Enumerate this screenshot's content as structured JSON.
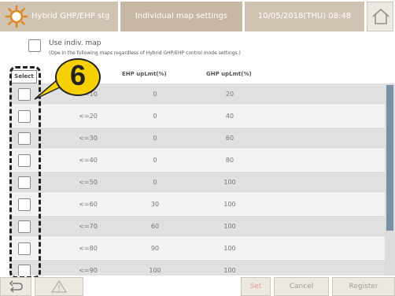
{
  "header": {
    "title": "Hybrid GHP/EHP stg",
    "mode": "Individual map settings",
    "datetime": "10/05/2018(THU) 08:48",
    "sun_icon": "sun-icon",
    "home_icon": "home-icon"
  },
  "use_map": {
    "label": "Use indiv. map",
    "note": "(Ope          in the following maps regardless of Hybrid GHP/EHP control mode settings.)"
  },
  "table": {
    "select_header": "Select",
    "columns": [
      "EHP upLmt(%)",
      "GHP upLmt(%)"
    ],
    "rows": [
      {
        "cond": "<=10",
        "ehp": "0",
        "ghp": "20"
      },
      {
        "cond": "<=20",
        "ehp": "0",
        "ghp": "40"
      },
      {
        "cond": "<=30",
        "ehp": "0",
        "ghp": "60"
      },
      {
        "cond": "<=40",
        "ehp": "0",
        "ghp": "80"
      },
      {
        "cond": "<=50",
        "ehp": "0",
        "ghp": "100"
      },
      {
        "cond": "<=60",
        "ehp": "30",
        "ghp": "100"
      },
      {
        "cond": "<=70",
        "ehp": "60",
        "ghp": "100"
      },
      {
        "cond": "<=80",
        "ehp": "90",
        "ghp": "100"
      },
      {
        "cond": "<=90",
        "ehp": "100",
        "ghp": "100"
      }
    ]
  },
  "callout": {
    "number": "6"
  },
  "footer": {
    "back_icon": "back-arrow-icon",
    "warning_icon": "warning-icon",
    "set_label": "Set",
    "cancel_label": "Cancel",
    "register_label": "Register"
  },
  "colors": {
    "header_bg": "#d0c3b1",
    "row_alt": "#e0e0e0",
    "row_plain": "#f2f2f2",
    "callout": "#f7d000",
    "scroll_thumb": "#7c8ea8"
  }
}
